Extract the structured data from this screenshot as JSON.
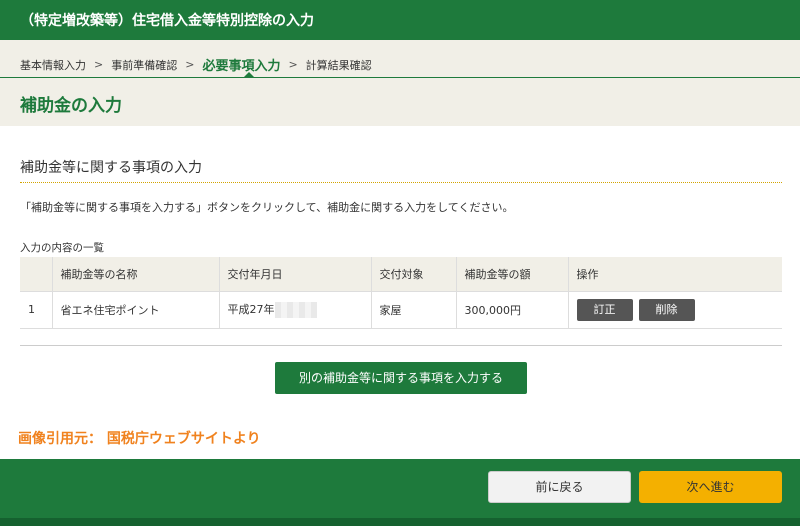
{
  "header": {
    "title": "（特定増改築等）住宅借入金等特別控除の入力"
  },
  "breadcrumb": {
    "items": [
      "基本情報入力",
      "事前準備確認",
      "必要事項入力",
      "計算結果確認"
    ],
    "separator": ">"
  },
  "page": {
    "title": "補助金の入力"
  },
  "section": {
    "heading": "補助金等に関する事項の入力",
    "instruction": "「補助金等に関する事項を入力する」ボタンをクリックして、補助金に関する入力をしてください。",
    "list_caption": "入力の内容の一覧"
  },
  "table": {
    "headers": [
      "",
      "補助金等の名称",
      "交付年月日",
      "交付対象",
      "補助金等の額",
      "操作"
    ],
    "rows": [
      {
        "no": "1",
        "name": "省エネ住宅ポイント",
        "date": "平成27年",
        "target": "家屋",
        "amount": "300,000円",
        "edit": "訂正",
        "delete": "削除"
      }
    ]
  },
  "actions": {
    "add_label": "別の補助金等に関する事項を入力する"
  },
  "credit": "画像引用元： 国税庁ウェブサイトより",
  "footer": {
    "back_label": "前に戻る",
    "next_label": "次へ進む"
  },
  "colors": {
    "brand_green": "#1e7a3c",
    "accent_yellow": "#f4b000",
    "credit_orange": "#f0821e"
  }
}
